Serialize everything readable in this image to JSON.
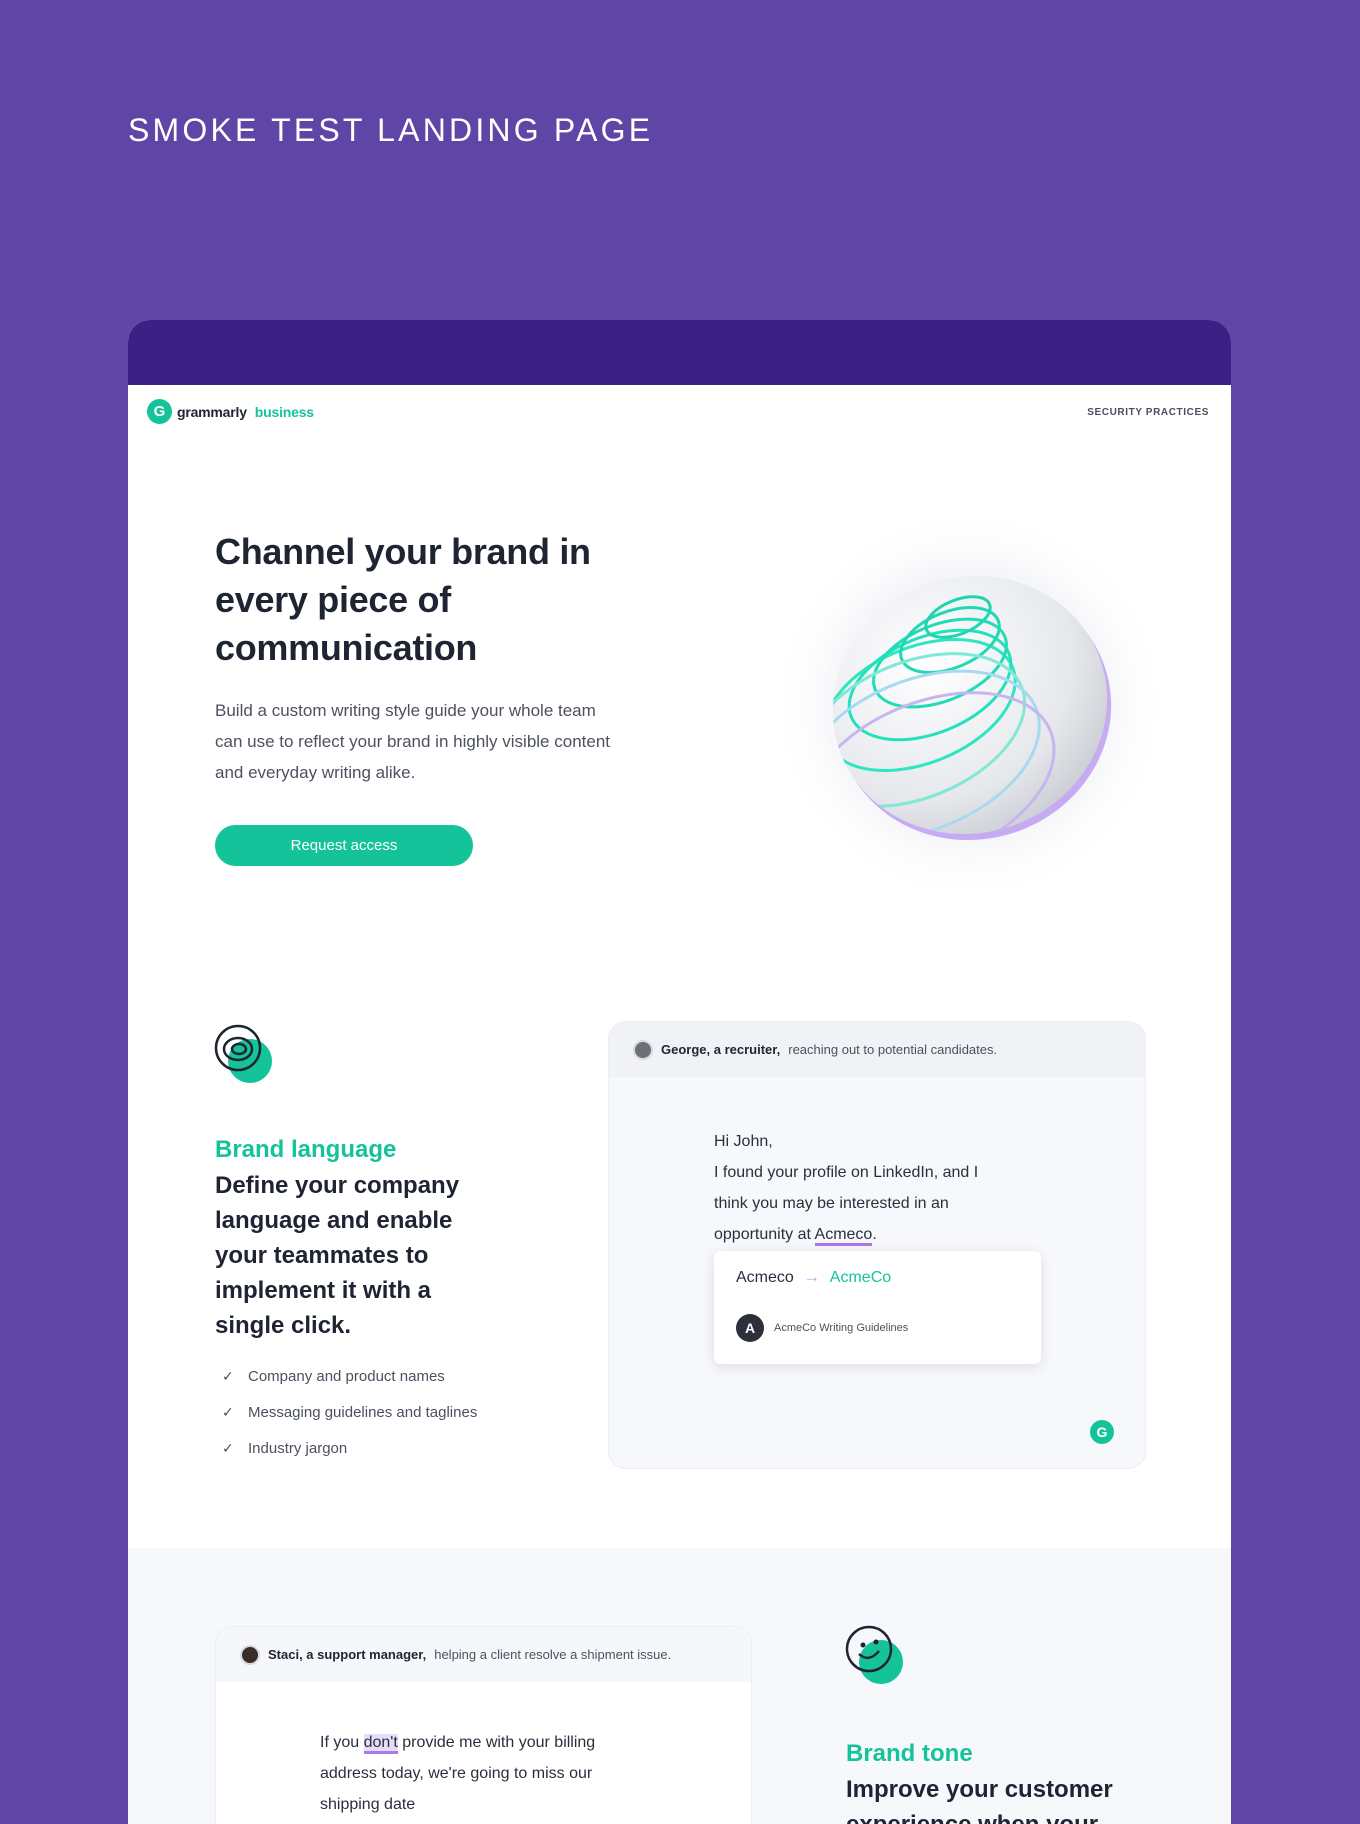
{
  "page_heading": "SMOKE TEST LANDING PAGE",
  "nav": {
    "logo_mark": "G",
    "logo_word": "grammarly",
    "logo_word2": "business",
    "security_link": "SECURITY PRACTICES"
  },
  "hero": {
    "title": "Channel your brand in every piece of communication",
    "body": "Build a custom writing style guide your whole team can use to reflect your brand in highly visible content and everyday writing alike.",
    "cta": "Request access"
  },
  "brand_language": {
    "kicker": "Brand language",
    "title": "Define your company language and enable your teammates to implement it with a single click.",
    "checklist": [
      "Company and product names",
      "Messaging guidelines and taglines",
      "Industry jargon"
    ],
    "card": {
      "persona_name": "George, a recruiter,",
      "persona_context": "reaching out to potential candidates.",
      "email_line1": "Hi John,",
      "email_line2": "I found your profile on LinkedIn, and I",
      "email_line3": "think you may be interested in an",
      "email_line4_pre": "opportunity at ",
      "email_line4_hl": "Acmeco",
      "email_line4_post": ".",
      "suggestion_old": "Acmeco",
      "suggestion_arrow": "→",
      "suggestion_new": "AcmeCo",
      "guideline_badge": "A",
      "guideline_label": "AcmeCo Writing Guidelines",
      "grammarly_badge": "G"
    }
  },
  "brand_tone": {
    "kicker": "Brand tone",
    "title": "Improve your customer experience when your",
    "card": {
      "persona_name": "Staci, a support manager,",
      "persona_context": "helping a client resolve a shipment issue.",
      "email_line1_pre": "If you ",
      "email_line1_hl": "don't",
      "email_line1_post": " provide me with your billing",
      "email_line2": "address today, we're going to miss our",
      "email_line3": "shipping date"
    }
  },
  "colors": {
    "page_background": "#5f45a5",
    "frame_bar": "#3d2085",
    "accent_green": "#15c39a",
    "highlight_purple": "#a77be8",
    "text_dark": "#1f2433"
  },
  "icons": [
    "grammarly-logo-icon",
    "sphere-illustration",
    "target-rings-icon",
    "smiley-icon",
    "checkmark-icon",
    "arrow-right-icon"
  ]
}
